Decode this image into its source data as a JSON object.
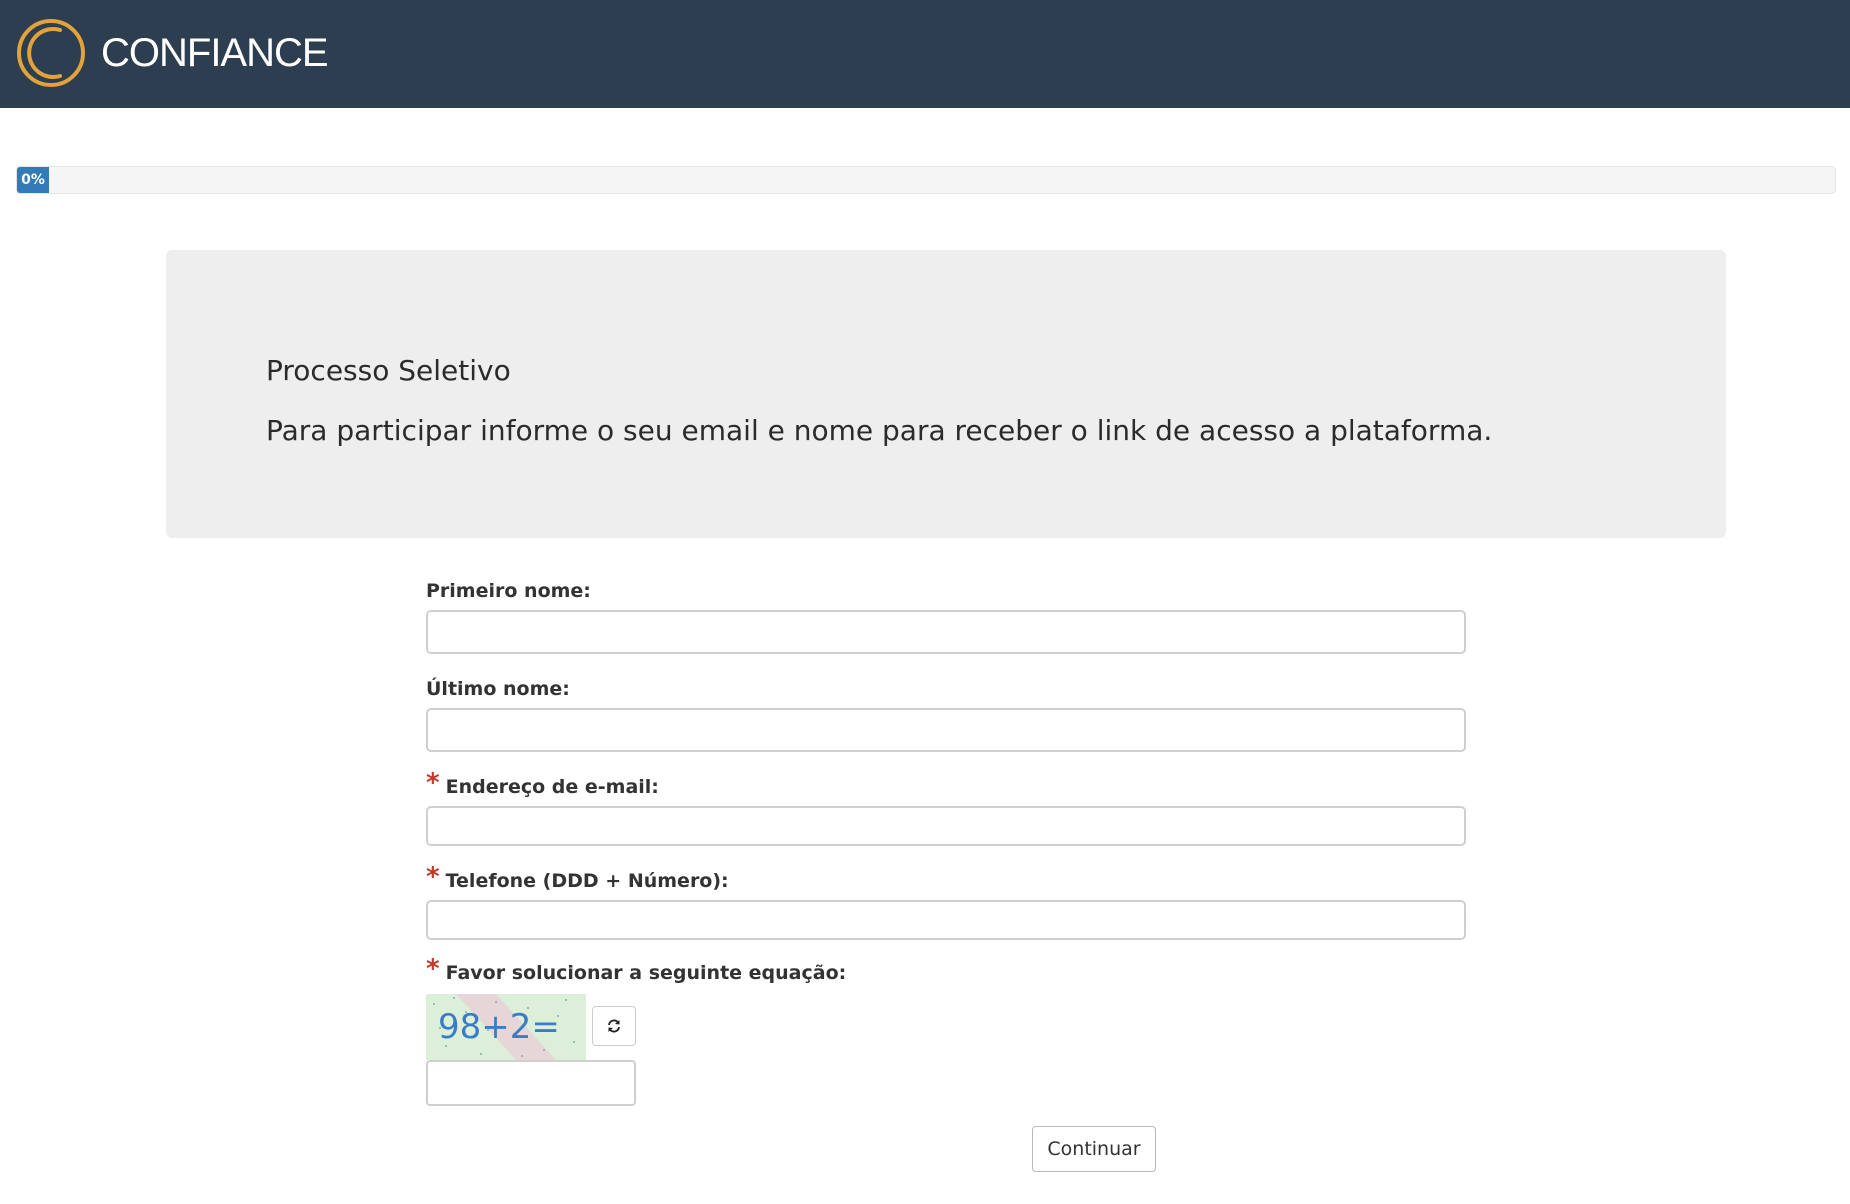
{
  "header": {
    "brand": "CONFIANCE",
    "logo_icon": "ring-logo-icon",
    "background_color": "#2d3e51",
    "logo_ring_color": "#e2a33b"
  },
  "progress": {
    "percent": 0,
    "label": "0%",
    "fill_color": "#337ab7"
  },
  "welcome": {
    "title": "Processo Seletivo",
    "description": "Para participar informe o seu email e nome para receber o link de acesso a plataforma."
  },
  "form": {
    "first_name": {
      "label": "Primeiro nome:",
      "value": "",
      "required": false
    },
    "last_name": {
      "label": "Último nome:",
      "value": "",
      "required": false
    },
    "email": {
      "label": "Endereço de e-mail:",
      "value": "",
      "required": true
    },
    "phone": {
      "label": "Telefone (DDD + Número):",
      "value": "",
      "required": true
    },
    "captcha": {
      "label": "Favor solucionar a seguinte equação:",
      "image_text": "98+2=",
      "value": "",
      "required": true,
      "refresh_icon": "refresh-icon"
    },
    "required_marker": "*",
    "required_color": "#c0392b",
    "submit_label": "Continuar"
  }
}
